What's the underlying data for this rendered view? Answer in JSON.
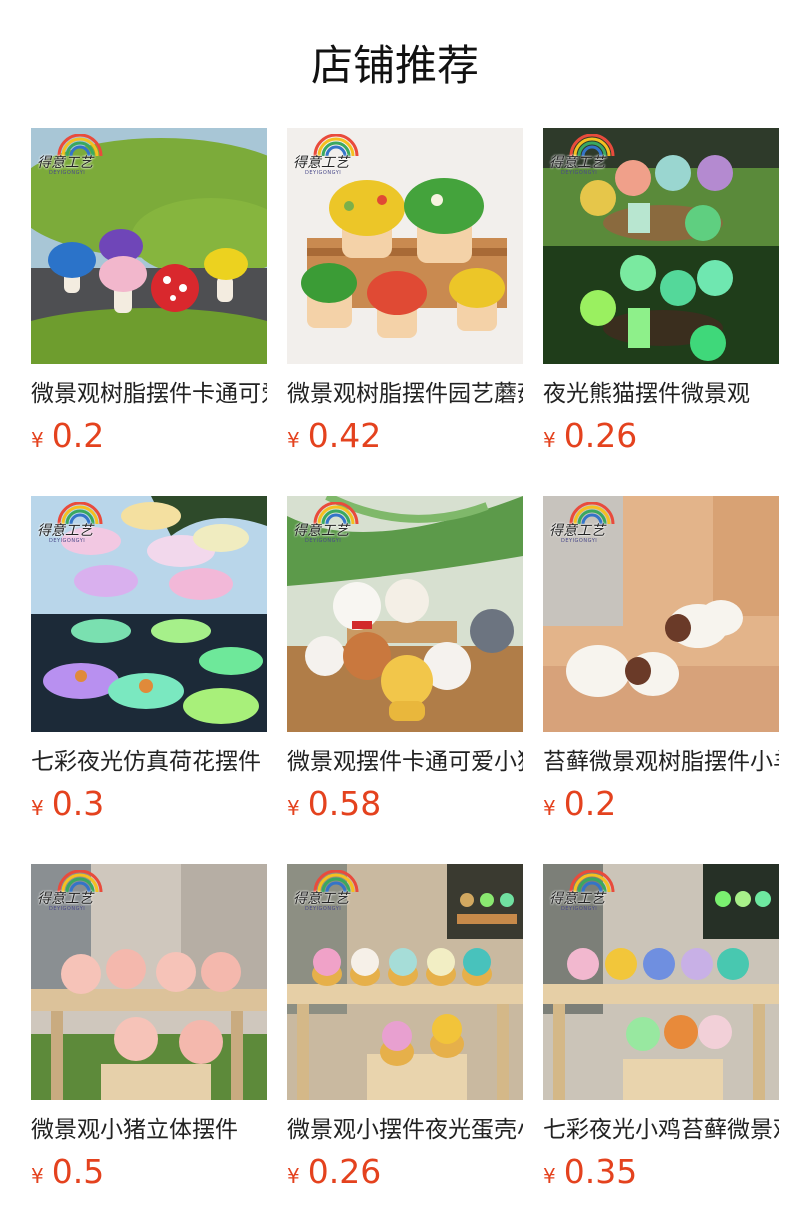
{
  "page_title": "店铺推荐",
  "brand": {
    "logo_text": "得意工艺",
    "logo_sub": "DEYIGONGYI"
  },
  "currency_symbol": "¥",
  "products": [
    {
      "name": "微景观树脂摆件卡通可爱小蘑菇",
      "price": "0.2",
      "icon": "mushroom-figurines"
    },
    {
      "name": "微景观树脂摆件园艺蘑菇房子",
      "price": "0.42",
      "icon": "mushroom-house-figurines"
    },
    {
      "name": "夜光熊猫摆件微景观",
      "price": "0.26",
      "icon": "glow-panda-figurines"
    },
    {
      "name": "七彩夜光仿真荷花摆件",
      "price": "0.3",
      "icon": "glow-lotus-figurines"
    },
    {
      "name": "微景观摆件卡通可爱小狗",
      "price": "0.58",
      "icon": "puppy-figurines"
    },
    {
      "name": "苔藓微景观树脂摆件小羊",
      "price": "0.2",
      "icon": "sheep-figurines"
    },
    {
      "name": "微景观小猪立体摆件",
      "price": "0.5",
      "icon": "pig-figurines"
    },
    {
      "name": "微景观小摆件夜光蛋壳小鸡",
      "price": "0.26",
      "icon": "eggshell-chick-figurines"
    },
    {
      "name": "七彩夜光小鸡苔藓微景观",
      "price": "0.35",
      "icon": "glow-chick-figurines"
    }
  ]
}
